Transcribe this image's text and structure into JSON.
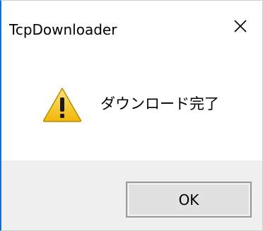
{
  "window": {
    "title": "TcpDownloader"
  },
  "message": {
    "icon": "warning-icon",
    "text": "ダウンロード完了"
  },
  "buttons": {
    "ok_label": "OK"
  },
  "colors": {
    "accent_border": "#1b6fc8",
    "footer_bg": "#f0f0f0",
    "button_bg": "#e1e1e1",
    "warning_yellow": "#f7c531"
  }
}
